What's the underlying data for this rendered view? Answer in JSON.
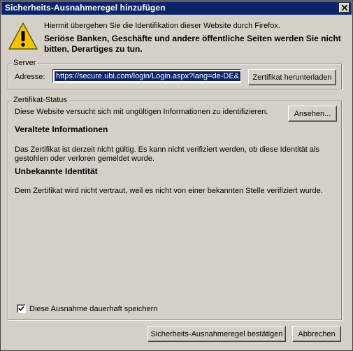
{
  "window": {
    "title": "Sicherheits-Ausnahmeregel hinzufügen"
  },
  "icons": {
    "warning": "warning-icon",
    "close": "close-icon",
    "check": "check-icon"
  },
  "message": {
    "line1": "Hiermit übergehen Sie die Identifikation dieser Website durch Firefox.",
    "line2": "Seriöse Banken, Geschäfte und andere öffentliche Seiten werden Sie nicht bitten, Derartiges zu tun."
  },
  "server": {
    "legend": "Server",
    "address_label": "Adresse:",
    "url": "https://secure.ubi.com/login/Login.aspx?lang=de-DE&",
    "download_button": "Zertifikat herunterladen"
  },
  "status": {
    "legend": "Zertifikat-Status",
    "intro": "Diese Website versucht sich mit ungültigen Informationen zu identifizieren.",
    "view_button": "Ansehen...",
    "outdated_heading": "Veraltete Informationen",
    "outdated_text_1": "Das Zertifikat ist derzeit nicht gültig. Es kann nicht verifiziert werden, ob diese Identität als",
    "outdated_text_2": "gestohlen oder verloren gemeldet wurde.",
    "unknown_heading": "Unbekannte Identität",
    "unknown_text": "Dem Zertifikat wird nicht vertraut, weil es nicht von einer bekannten Stelle verifiziert wurde."
  },
  "permanent": {
    "label": "Diese Ausnahme dauerhaft speichern",
    "checked": true
  },
  "buttons": {
    "confirm": "Sicherheits-Ausnahmeregel bestätigen",
    "cancel": "Abbrechen"
  },
  "colors": {
    "titlebar": "#0a246a",
    "dialog": "#d4d0c8",
    "warning": "#f5c400"
  }
}
